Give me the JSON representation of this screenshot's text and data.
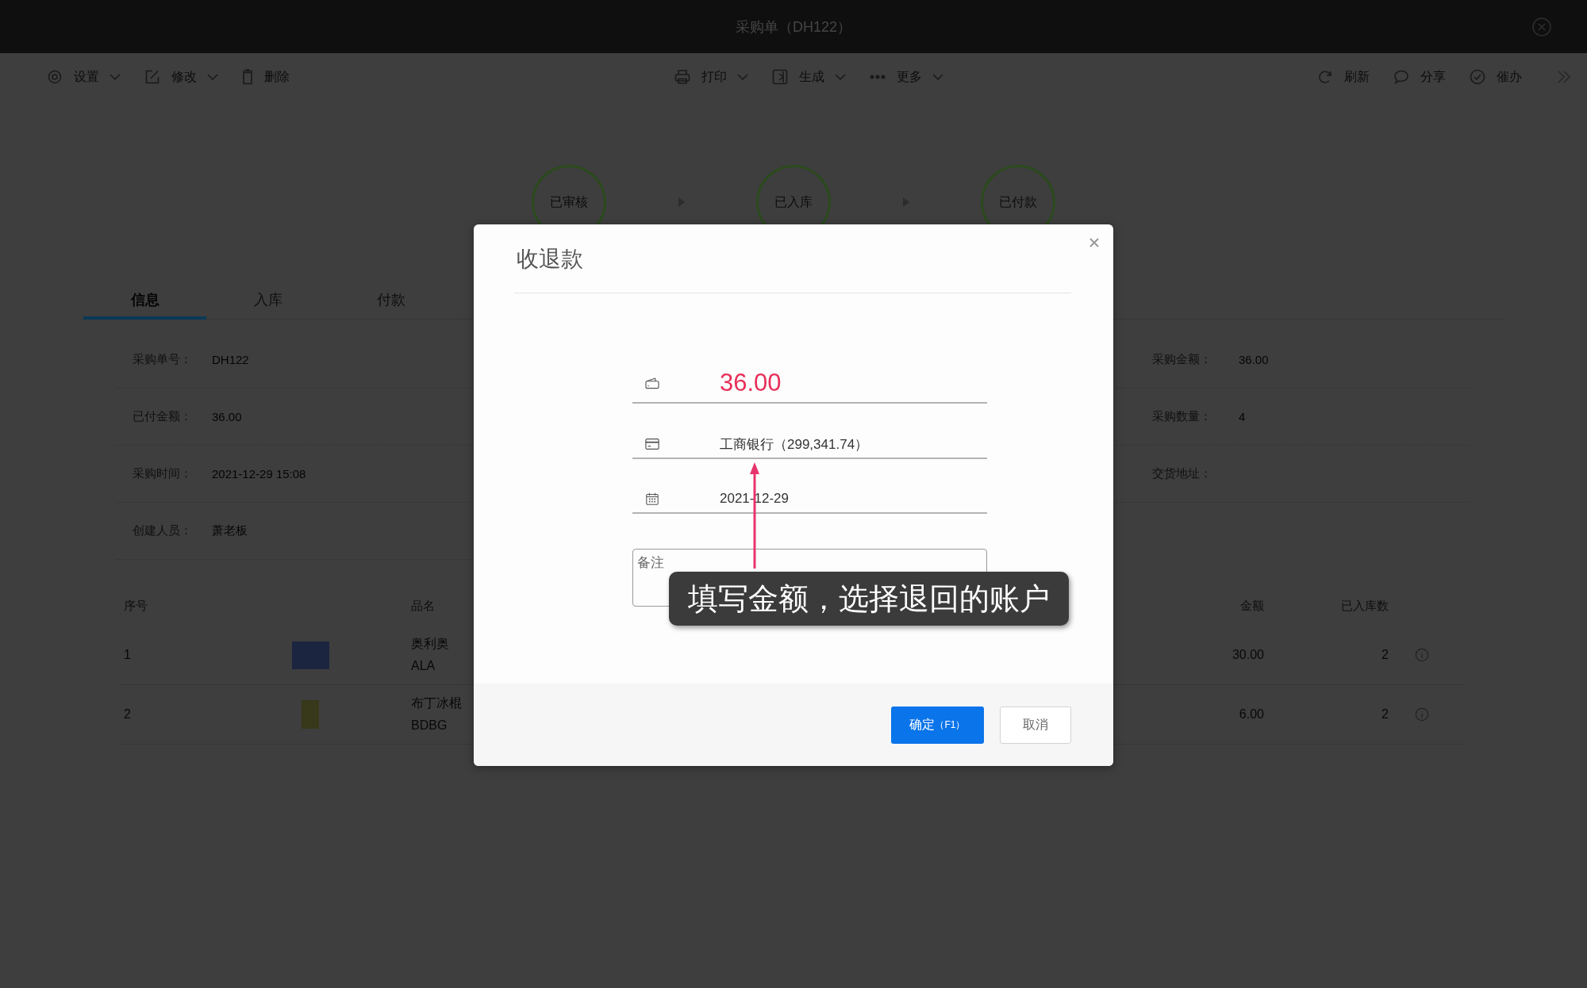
{
  "window": {
    "title": "采购单（DH122）"
  },
  "toolbar": {
    "left": [
      {
        "label": "设置",
        "dropdown": true
      },
      {
        "label": "修改",
        "dropdown": true
      },
      {
        "label": "删除",
        "dropdown": false
      }
    ],
    "center": [
      {
        "label": "打印",
        "dropdown": true
      },
      {
        "label": "生成",
        "dropdown": true
      },
      {
        "label": "更多",
        "dropdown": true
      }
    ],
    "right": [
      {
        "label": "刷新",
        "dropdown": false
      },
      {
        "label": "分享",
        "dropdown": false
      },
      {
        "label": "催办",
        "dropdown": false
      }
    ]
  },
  "steps": [
    {
      "label": "已审核"
    },
    {
      "label": "已入库"
    },
    {
      "label": "已付款"
    }
  ],
  "tabs": [
    {
      "label": "信息",
      "selected": true
    },
    {
      "label": "入库",
      "selected": false
    },
    {
      "label": "付款",
      "selected": false
    }
  ],
  "info": {
    "left": [
      {
        "label": "采购单号：",
        "value": "DH122"
      },
      {
        "label": "已付金额：",
        "value": "36.00"
      },
      {
        "label": "采购时间：",
        "value": "2021-12-29 15:08"
      },
      {
        "label": "创建人员：",
        "value": "萧老板"
      }
    ],
    "right": [
      {
        "label": "采购金额：",
        "value": "36.00"
      },
      {
        "label": "采购数量：",
        "value": "4"
      },
      {
        "label": "交货地址："
      }
    ]
  },
  "table": {
    "columns": [
      {
        "label": "序号"
      },
      {
        "label": "品名"
      },
      {
        "label": "金额"
      },
      {
        "label": "已入库数"
      }
    ],
    "rows": [
      {
        "index": "1",
        "name": "奥利奥",
        "code": "ALA",
        "amount": "30.00",
        "received": "2"
      },
      {
        "index": "2",
        "name": "布丁冰棍",
        "code": "BDBG",
        "amount": "6.00",
        "received": "2"
      }
    ]
  },
  "dialog": {
    "title": "收退款",
    "amount": "36.00",
    "account": "工商银行（299,341.74）",
    "date": "2021-12-29",
    "remark": {
      "placeholder": "备注"
    },
    "buttons": [
      {
        "label": "确定",
        "shortcut": "（F1）",
        "kind": "primary"
      },
      {
        "label": "取消",
        "kind": "secondary"
      }
    ]
  },
  "callout": {
    "text": "填写金额，选择退回的账户"
  }
}
